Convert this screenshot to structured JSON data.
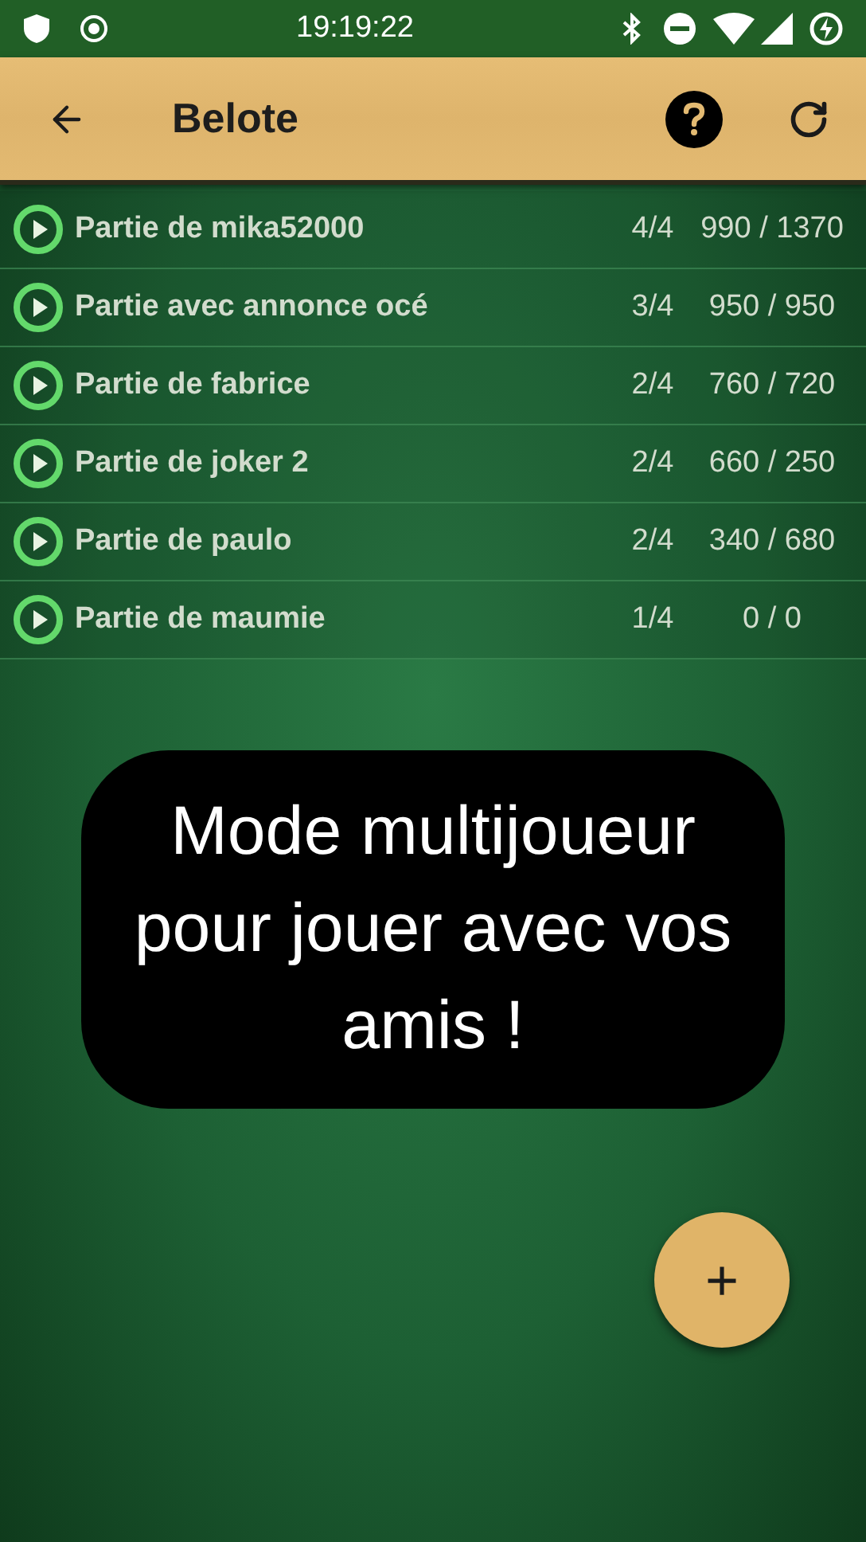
{
  "status_bar": {
    "time": "19:19:22"
  },
  "toolbar": {
    "title": "Belote"
  },
  "games": [
    {
      "name": "Partie de mika52000",
      "players": "4/4",
      "score": "990 / 1370"
    },
    {
      "name": "Partie avec annonce océ",
      "players": "3/4",
      "score": "950 / 950"
    },
    {
      "name": "Partie de fabrice",
      "players": "2/4",
      "score": "760 / 720"
    },
    {
      "name": "Partie de joker 2",
      "players": "2/4",
      "score": "660 / 250"
    },
    {
      "name": "Partie de paulo",
      "players": "2/4",
      "score": "340 / 680"
    },
    {
      "name": "Partie de maumie",
      "players": "1/4",
      "score": "0 / 0"
    }
  ],
  "tip": {
    "text": "Mode multijoueur pour jouer avec vos amis !"
  },
  "fab": {
    "label": "+"
  }
}
